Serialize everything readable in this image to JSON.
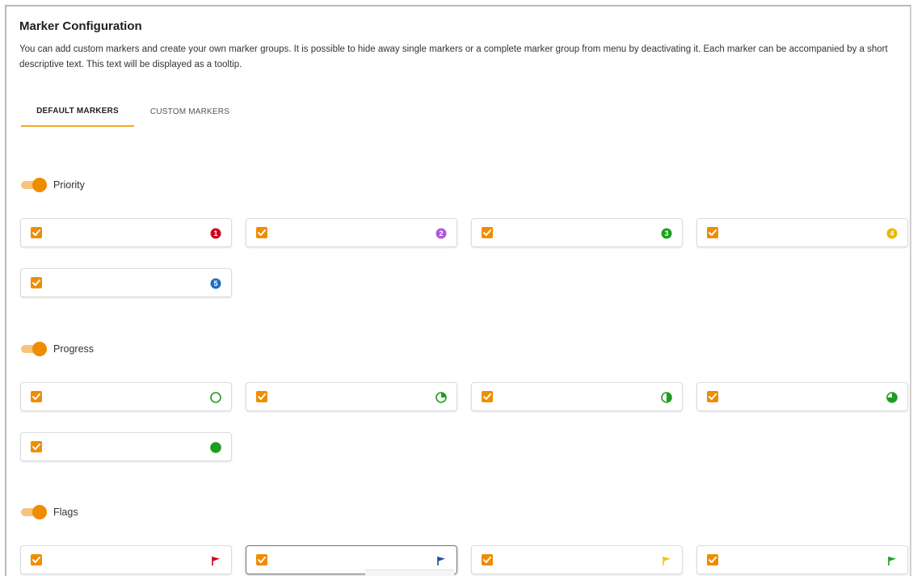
{
  "header": {
    "title": "Marker Configuration",
    "description": "You can add custom markers and create your own marker groups. It is possible to hide away single markers or a complete marker group from menu by deactivating it. Each marker can be accompanied by a short descriptive text. This text will be displayed as a tooltip."
  },
  "tabs": [
    {
      "label": "DEFAULT MARKERS",
      "active": true
    },
    {
      "label": "CUSTOM MARKERS",
      "active": false
    }
  ],
  "groups": [
    {
      "label": "Priority",
      "enabled": true,
      "markers": [
        {
          "icon": "priority-1-icon",
          "glyph": "1",
          "color": "#d0021b",
          "checked": true
        },
        {
          "icon": "priority-2-icon",
          "glyph": "2",
          "color": "#b455e0",
          "checked": true
        },
        {
          "icon": "priority-3-icon",
          "glyph": "3",
          "color": "#1e9e1e",
          "checked": true
        },
        {
          "icon": "priority-4-icon",
          "glyph": "4",
          "color": "#e6b800",
          "checked": true
        },
        {
          "icon": "priority-5-icon",
          "glyph": "5",
          "color": "#1f6fc2",
          "checked": true
        }
      ]
    },
    {
      "label": "Progress",
      "enabled": true,
      "markers": [
        {
          "icon": "progress-0-icon",
          "fraction": 0,
          "color": "#1e9e1e",
          "checked": true
        },
        {
          "icon": "progress-25-icon",
          "fraction": 0.25,
          "color": "#1e9e1e",
          "checked": true
        },
        {
          "icon": "progress-50-icon",
          "fraction": 0.5,
          "color": "#1e9e1e",
          "checked": true
        },
        {
          "icon": "progress-75-icon",
          "fraction": 0.75,
          "color": "#1e9e1e",
          "checked": true
        },
        {
          "icon": "progress-100-icon",
          "fraction": 1,
          "color": "#1e9e1e",
          "checked": true
        }
      ]
    },
    {
      "label": "Flags",
      "enabled": true,
      "markers": [
        {
          "icon": "flag-red-icon",
          "color": "#d0021b",
          "checked": true
        },
        {
          "icon": "flag-blue-icon",
          "color": "#1f4fa0",
          "checked": true,
          "focused": true
        },
        {
          "icon": "flag-yellow-icon",
          "color": "#f0c419",
          "checked": true
        },
        {
          "icon": "flag-green-icon",
          "color": "#1e9e1e",
          "checked": true
        }
      ]
    }
  ],
  "colors": {
    "accent": "#f08c00",
    "toggle_track": "#f6c47c",
    "tab_indicator": "#f5a623"
  }
}
